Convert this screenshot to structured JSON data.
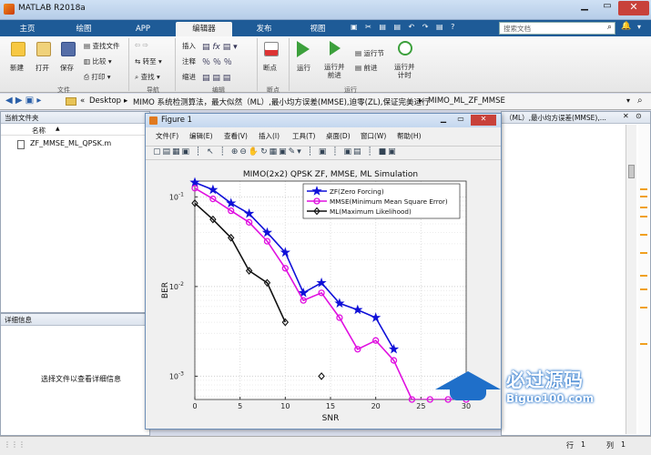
{
  "app": {
    "title": "MATLAB R2018a"
  },
  "tabs": [
    "主页",
    "绘图",
    "APP",
    "编辑器",
    "发布",
    "视图"
  ],
  "search": {
    "placeholder": "搜索文档"
  },
  "ribbon": {
    "new": "新建",
    "open": "打开",
    "save": "保存",
    "find_files": "查找文件",
    "compare": "比较",
    "print": "打印",
    "goto": "转至",
    "find": "查找",
    "insert": "插入",
    "comment": "注释",
    "indent": "缩进",
    "breakpoint": "断点",
    "run": "运行",
    "run_advance": "运行并\n前进",
    "run_section": "运行节",
    "advance": "前进",
    "run_time": "运行并\n计时",
    "groups": {
      "file": "文件",
      "nav": "导航",
      "edit": "编辑",
      "bp": "断点",
      "run": "运行"
    }
  },
  "address": {
    "parts": [
      "«",
      "Desktop",
      "MIMO 系统检测算法，最大似然（ML）,最小均方误差(MMSE),迫零(ZL),保证完美运行",
      "MIMO_ML_ZF_MMSE"
    ]
  },
  "current_folder": {
    "title": "当前文件夹",
    "col_name": "名称",
    "sort": "▲",
    "files": [
      "ZF_MMSE_ML_QPSK.m"
    ]
  },
  "details": {
    "title": "详细信息",
    "hint": "选择文件以查看详细信息"
  },
  "right_header": "（ML）,最小均方误差(MMSE),...",
  "figure": {
    "title": "Figure 1",
    "menus": [
      "文件(F)",
      "编辑(E)",
      "查看(V)",
      "插入(I)",
      "工具(T)",
      "桌面(D)",
      "窗口(W)",
      "帮助(H)"
    ]
  },
  "status": {
    "row_label": "行",
    "row": "1",
    "col_label": "列",
    "col": "1"
  },
  "watermark": {
    "main": "必过源码",
    "sub": "Biguo100.com"
  },
  "chart_data": {
    "type": "line",
    "title": "MIMO(2x2) QPSK ZF, MMSE, ML Simulation",
    "xlabel": "SNR",
    "ylabel": "BER",
    "xlim": [
      0,
      30
    ],
    "ylim": [
      0.00055,
      0.15
    ],
    "yscale": "log",
    "xticks": [
      0,
      5,
      10,
      15,
      20,
      25,
      30
    ],
    "yticks": [
      {
        "v": 0.1,
        "label": "10^-1"
      },
      {
        "v": 0.01,
        "label": "10^-2"
      },
      {
        "v": 0.001,
        "label": "10^-3"
      }
    ],
    "grid": true,
    "legend_position": "top-right",
    "series": [
      {
        "name": "ZF(Zero Forcing)",
        "color": "#1010d8",
        "marker": "star",
        "x": [
          0,
          2,
          4,
          6,
          8,
          10,
          12,
          14,
          16,
          18,
          20,
          22
        ],
        "y": [
          0.145,
          0.12,
          0.085,
          0.065,
          0.04,
          0.024,
          0.0085,
          0.011,
          0.0065,
          0.0055,
          0.0045,
          0.002
        ]
      },
      {
        "name": "MMSE(Minimum Mean Square Error)",
        "color": "#e010e0",
        "marker": "circle",
        "x": [
          0,
          2,
          4,
          6,
          8,
          10,
          12,
          14,
          16,
          18,
          20,
          22,
          24,
          26,
          28,
          30
        ],
        "y": [
          0.125,
          0.095,
          0.07,
          0.052,
          0.032,
          0.016,
          0.007,
          0.0085,
          0.0045,
          0.002,
          0.0025,
          0.0015,
          0.00055,
          0.00055,
          0.00055,
          0.00055
        ]
      },
      {
        "name": "ML(Maximum Likelihood)",
        "color": "#111111",
        "marker": "diamond",
        "x": [
          0,
          2,
          4,
          6,
          8,
          10
        ],
        "y": [
          0.085,
          0.056,
          0.035,
          0.015,
          0.011,
          0.004
        ]
      },
      {
        "name": "",
        "color": "#111111",
        "marker": "diamond",
        "x": [
          14
        ],
        "y": [
          0.001
        ]
      }
    ]
  }
}
